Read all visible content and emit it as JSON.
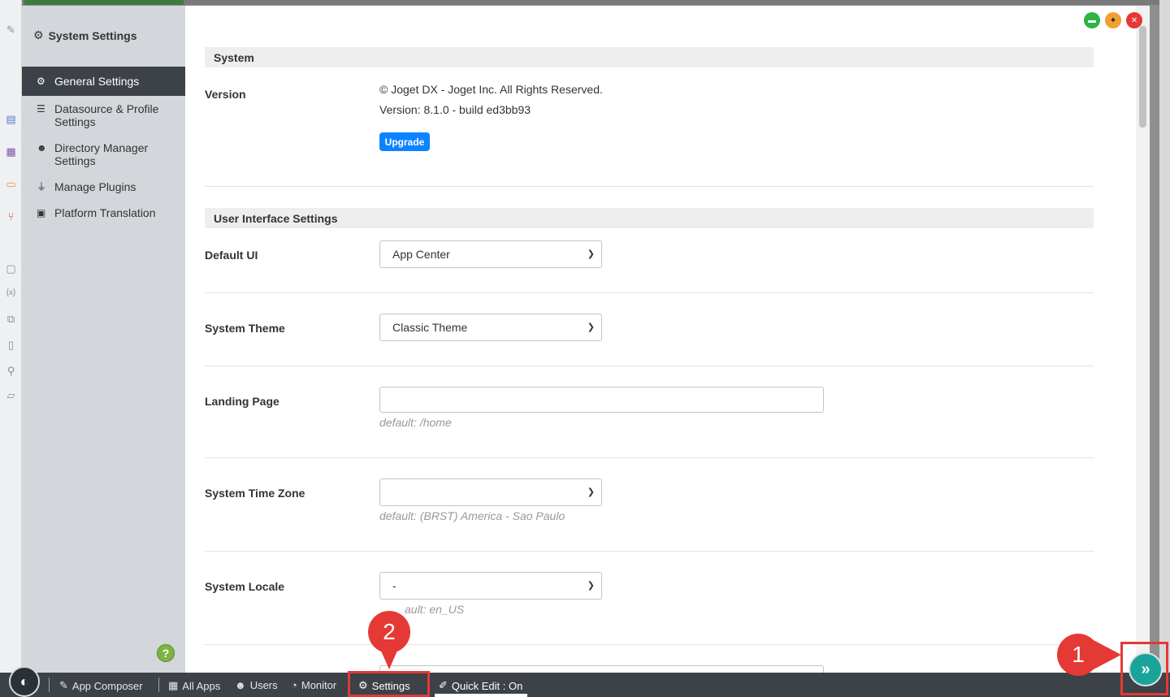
{
  "sidebar": {
    "title": "System Settings",
    "items": [
      {
        "label": "General Settings",
        "icon": "gear-icon",
        "active": true
      },
      {
        "label": "Datasource & Profile Settings",
        "icon": "database-icon",
        "active": false
      },
      {
        "label": "Directory Manager Settings",
        "icon": "users-icon",
        "active": false
      },
      {
        "label": "Manage Plugins",
        "icon": "plug-icon",
        "active": false
      },
      {
        "label": "Platform Translation",
        "icon": "language-icon",
        "active": false
      }
    ],
    "help_label": "?"
  },
  "system": {
    "section_title": "System",
    "version_label": "Version",
    "copyright": "© Joget DX - Joget Inc. All Rights Reserved.",
    "version_text": "Version: 8.1.0 - build ed3bb93",
    "upgrade_label": "Upgrade"
  },
  "ui_settings": {
    "section_title": "User Interface Settings",
    "default_ui": {
      "label": "Default UI",
      "value": "App Center"
    },
    "system_theme": {
      "label": "System Theme",
      "value": "Classic Theme"
    },
    "landing_page": {
      "label": "Landing Page",
      "value": "",
      "hint": "default: /home"
    },
    "time_zone": {
      "label": "System Time Zone",
      "value": "",
      "hint": "default: (BRST) America - Sao Paulo"
    },
    "locale": {
      "label": "System Locale",
      "value": "-",
      "hint": "default: en_US",
      "hint_visible": "ault: en_US"
    }
  },
  "bottombar": {
    "app_composer": "App Composer",
    "all_apps": "All Apps",
    "users": "Users",
    "monitor": "Monitor",
    "settings": "Settings",
    "quick_edit": "Quick Edit : On"
  },
  "callouts": {
    "one": "1",
    "two": "2"
  },
  "colors": {
    "accent": "#0d84ff",
    "sidebar_active": "#3c4247",
    "callout": "#e53935",
    "fab": "#1aa39a"
  }
}
